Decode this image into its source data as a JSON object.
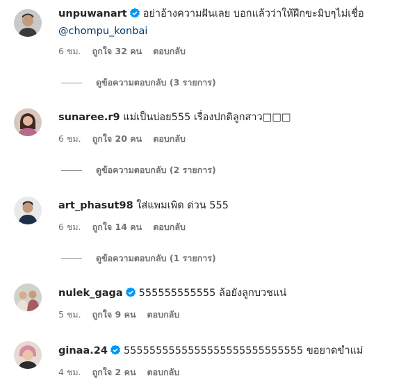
{
  "comments": [
    {
      "username": "unpuwanart",
      "verified": true,
      "text": "อย่าอ้างความฝันเลย บอกแล้วว่าให้ฝึกขะมิบๆไม่เชื่อ",
      "mention": "@chompu_konbai",
      "time": "6 ชม.",
      "likes": "ถูกใจ 32 คน",
      "reply": "ตอบกลับ",
      "view_replies": "ดูข้อความตอบกลับ (3 รายการ)"
    },
    {
      "username": "sunaree.r9",
      "verified": false,
      "text": "แม่เป็นบ่อย555 เรื่องปกติลูกสาว□□□",
      "time": "6 ชม.",
      "likes": "ถูกใจ 20 คน",
      "reply": "ตอบกลับ",
      "view_replies": "ดูข้อความตอบกลับ (2 รายการ)"
    },
    {
      "username": "art_phasut98",
      "verified": false,
      "text": "ใส่แพมเพิด ด่วน 555",
      "time": "6 ชม.",
      "likes": "ถูกใจ 14 คน",
      "reply": "ตอบกลับ",
      "view_replies": "ดูข้อความตอบกลับ (1 รายการ)"
    },
    {
      "username": "nulek_gaga",
      "verified": true,
      "text": "555555555555 ล้อยังลูกบวชแน่",
      "time": "5 ชม.",
      "likes": "ถูกใจ 9 คน",
      "reply": "ตอบกลับ"
    },
    {
      "username": "ginaa.24",
      "verified": true,
      "text": "5555555555555555555555555555 ขอยาดขำแม่",
      "time": "4 ชม.",
      "likes": "ถูกใจ 2 คน",
      "reply": "ตอบกลับ"
    }
  ],
  "colors": {
    "verified_badge": "#0095f6",
    "meta_text": "#737373",
    "mention": "#00376b"
  }
}
